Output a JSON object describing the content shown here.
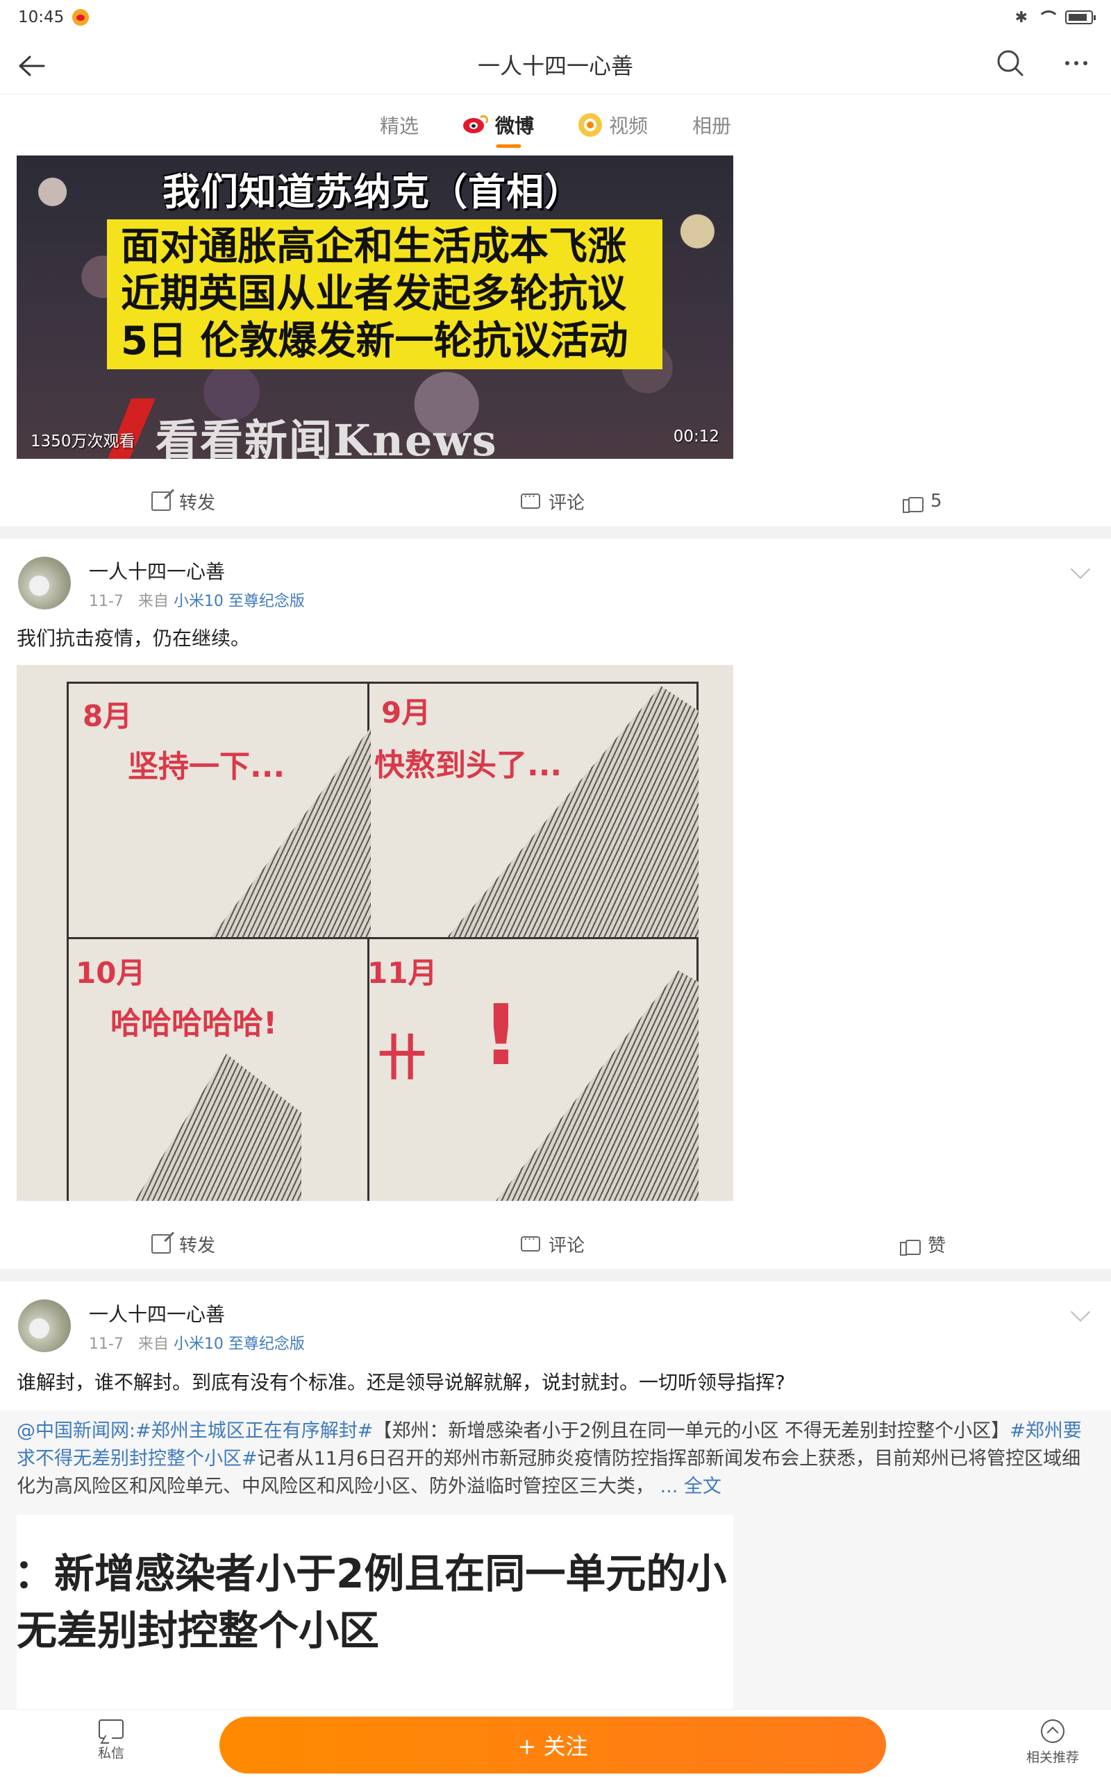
{
  "status_bar": {
    "time": "10:45"
  },
  "nav": {
    "title": "一人十四一心善"
  },
  "tabs": [
    {
      "label": "精选"
    },
    {
      "label": "微博"
    },
    {
      "label": "视频"
    },
    {
      "label": "相册"
    }
  ],
  "video_post": {
    "headline": "我们知道苏纳克（首相）",
    "subtitle_lines": [
      "面对通胀高企和生活成本飞涨",
      "近期英国从业者发起多轮抗议",
      "5日 伦敦爆发新一轮抗议活动"
    ],
    "brand": "看看新闻Knews",
    "views": "1350万次观看",
    "duration": "00:12",
    "actions": {
      "share": "转发",
      "comment": "评论",
      "like": "5"
    }
  },
  "post1": {
    "author": "一人十四一心善",
    "date": "11-7",
    "from_label": "来自",
    "source": "小米10 至尊纪念版",
    "text": "我们抗击疫情，仍在继续。",
    "comic": {
      "panels": [
        {
          "month": "8月",
          "caption": "坚持一下..."
        },
        {
          "month": "9月",
          "caption": "快熬到头了..."
        },
        {
          "month": "10月",
          "caption": "哈哈哈哈哈!"
        },
        {
          "month": "11月",
          "caption": "卄"
        }
      ],
      "exclaim": "!"
    },
    "actions": {
      "share": "转发",
      "comment": "评论",
      "like": "赞"
    }
  },
  "post2": {
    "author": "一人十四一心善",
    "date": "11-7",
    "from_label": "来自",
    "source": "小米10 至尊纪念版",
    "text": "谁解封，谁不解封。到底有没有个标准。还是领导说解就解，说封就封。一切听领导指挥?",
    "repost": {
      "mention": "@中国新闻网",
      "topic1": ":#郑州主城区正在有序解封#",
      "body1": "【郑州：新增感染者小于2例且在同一单元的小区 不得无差别封控整个小区】",
      "topic2": "#郑州要求不得无差别封控整个小区#",
      "body2": "记者从11月6日召开的郑州市新冠肺炎疫情防控指挥部新闻发布会上获悉，目前郑州已将管控区域细化为高风险区和风险单元、中风险区和风险小区、防外溢临时管控区三大类，",
      "more": "... 全文",
      "image_lines": [
        "：新增感染者小于2例且在同一单元的小",
        "无差别封控整个小区"
      ]
    }
  },
  "bottom_bar": {
    "message": "私信",
    "follow": "+ 关注",
    "recommend": "相关推荐"
  }
}
